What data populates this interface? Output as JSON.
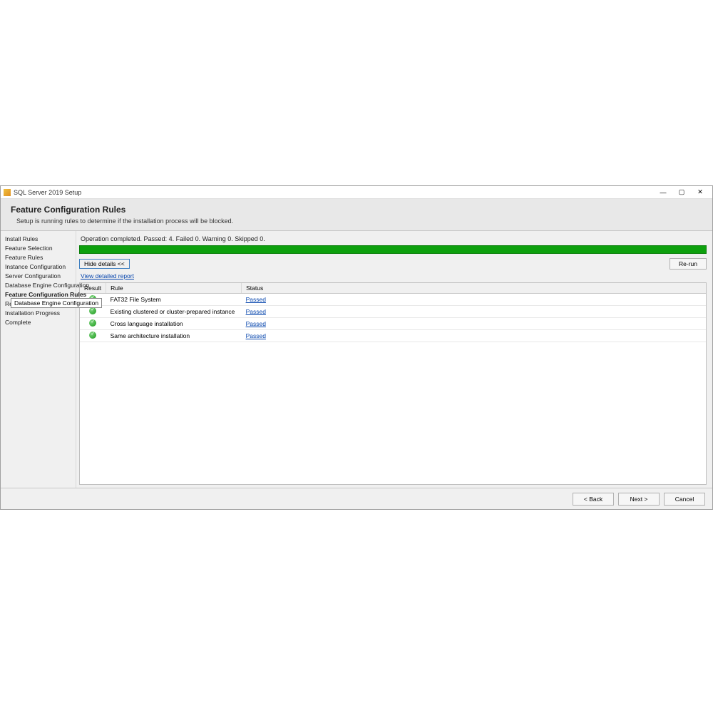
{
  "window": {
    "title": "SQL Server 2019 Setup"
  },
  "header": {
    "title": "Feature Configuration Rules",
    "subtitle": "Setup is running rules to determine if the installation process will be blocked."
  },
  "sidebar": {
    "items": [
      {
        "label": "Install Rules"
      },
      {
        "label": "Feature Selection"
      },
      {
        "label": "Feature Rules"
      },
      {
        "label": "Instance Configuration"
      },
      {
        "label": "Server Configuration"
      },
      {
        "label": "Database Engine Configuration"
      },
      {
        "label": "Feature Configuration Rules",
        "active": true
      },
      {
        "label": "Rea"
      },
      {
        "label": "Installation Progress"
      },
      {
        "label": "Complete"
      }
    ],
    "tooltip": "Database Engine Configuration"
  },
  "main": {
    "status": "Operation completed.  Passed: 4.   Failed 0.   Warning 0.   Skipped 0.",
    "hide_details_label": "Hide details <<",
    "rerun_label": "Re-run",
    "report_link": "View detailed report",
    "columns": {
      "result": "Result",
      "rule": "Rule",
      "status": "Status"
    },
    "rows": [
      {
        "rule": "FAT32 File System",
        "status": "Passed"
      },
      {
        "rule": "Existing clustered or cluster-prepared instance",
        "status": "Passed"
      },
      {
        "rule": "Cross language installation",
        "status": "Passed"
      },
      {
        "rule": "Same architecture installation",
        "status": "Passed"
      }
    ]
  },
  "footer": {
    "back": "< Back",
    "next": "Next >",
    "cancel": "Cancel"
  }
}
